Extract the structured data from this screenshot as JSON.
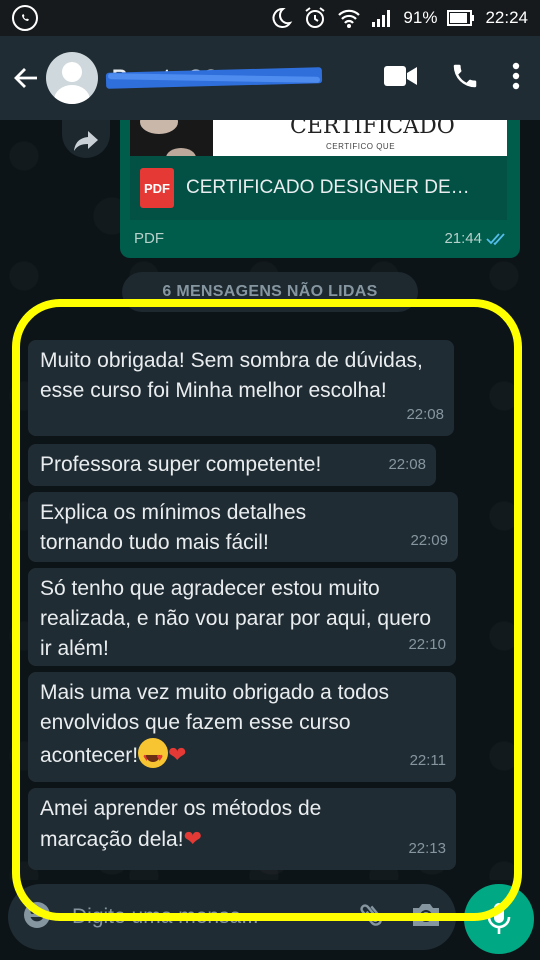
{
  "status_bar": {
    "battery": "91%",
    "time": "22:24"
  },
  "header": {
    "contact_name": "Renata CC"
  },
  "pdf_message": {
    "preview_title": "CERTIFICADO",
    "preview_subtitle": "CERTIFICO QUE",
    "file_badge": "PDF",
    "file_name": "CERTIFICADO DESIGNER DE…",
    "file_type": "PDF",
    "time": "21:44"
  },
  "unread_label": "6 MENSAGENS NÃO LIDAS",
  "messages": [
    {
      "text": "Muito obrigada! Sem sombra de dúvidas, esse curso  foi Minha melhor escolha!",
      "time": "22:08"
    },
    {
      "text": "Professora super competente!",
      "time": "22:08"
    },
    {
      "text": "Explica os mínimos detalhes tornando tudo mais fácil!",
      "time": "22:09"
    },
    {
      "text": "Só tenho que agradecer estou muito realizada, e não vou parar por aqui, quero ir além!",
      "time": "22:10"
    },
    {
      "text": "Mais uma vez muito obrigado a todos envolvidos que fazem esse curso acontecer!",
      "time": "22:11"
    },
    {
      "text": "Amei aprender os métodos de marcação dela!",
      "time": "22:13"
    }
  ],
  "composer": {
    "placeholder": "Digite uma mensa..."
  },
  "colors": {
    "highlight": "#ffff00",
    "outgoing_bubble": "#005c4b",
    "incoming_bubble": "#202c33",
    "accent": "#00a884"
  }
}
